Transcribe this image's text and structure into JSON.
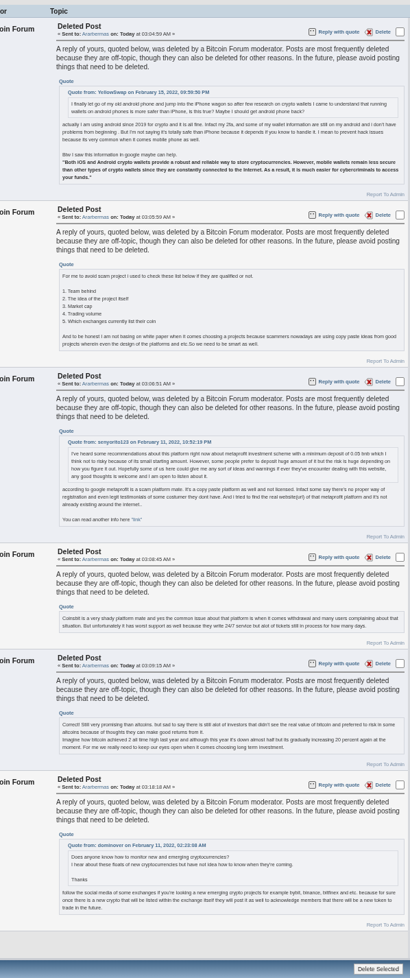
{
  "header": {
    "columns": [
      "or",
      "Topic"
    ]
  },
  "messages": [
    {
      "poster": "oin Forum",
      "title": "Deleted Post",
      "sent_prefix": "«",
      "sent_label": "Sent to:",
      "recipient": "Ararbermas",
      "on_label": "on:",
      "day": "Today",
      "time": "at 03:04:59 AM",
      "sent_suffix": "»",
      "reply": "Reply with quote",
      "delete": "Delete",
      "checked": false,
      "body": "A reply of yours, quoted below, was deleted by a Bitcoin Forum moderator. Posts are most frequently deleted because they are off-topic, though they can also be deleted for other reasons. In the future, please avoid posting things that need to be deleted.",
      "quote": {
        "label": "Quote",
        "nested": {
          "header": "Quote from: YellowSwap on February 15, 2022, 09:59:50 PM",
          "paragraphs": [
            {
              "lines": [
                "I finally let go of my old android phone and jump into the iPhone wagon so after few research on crypto wallets I came to understand that running wallets on android phones is more safer than iPhone, is this true? Maybe I should get android phone back?"
              ],
              "bold": false
            }
          ]
        },
        "paragraphs": [
          {
            "lines": [
              "actually I am using android since 2019 for crypto and it is all fine. Infact my 2fa, and some of my wallet information are still on my android and i don't have problems from beginning . But I'm not saying it's totally safe than iPhone because it depends if you know to handle it. I mean to prevent hack issues because its very common when it comes mobile phone as well."
            ],
            "bold": false
          },
          {
            "lines": [
              "Btw I saw this information in google maybe can help.",
              "**\"Both iOS and Android crypto wallets provide a robust and reliable way to store cryptocurrencies. However, mobile wallets remain less secure than other types of crypto wallets since they are constantly connected to the Internet. As a result, it is much easier for cybercriminals to access your funds.\"**"
            ],
            "bold": false
          }
        ]
      },
      "report": "Report To Admin"
    },
    {
      "poster": "oin Forum",
      "title": "Deleted Post",
      "sent_prefix": "«",
      "sent_label": "Sent to:",
      "recipient": "Ararbermas",
      "on_label": "on:",
      "day": "Today",
      "time": "at 03:05:59 AM",
      "sent_suffix": "»",
      "reply": "Reply with quote",
      "delete": "Delete",
      "checked": false,
      "body": "A reply of yours, quoted below, was deleted by a Bitcoin Forum moderator. Posts are most frequently deleted because they are off-topic, though they can also be deleted for other reasons. In the future, please avoid posting things that need to be deleted.",
      "quote": {
        "label": "Quote",
        "paragraphs": [
          {
            "lines": [
              "For me to avoid scam project i used to check these list below if they are qualified or not."
            ],
            "bold": false
          },
          {
            "lines": [
              "1. Team behind",
              "2. The idea of the project itself",
              "3. Market cap",
              "4.  Trading volume",
              "5. Which exchanges currently list their coin"
            ],
            "bold": false
          },
          {
            "lines": [
              "And to be honest I am not basing on white paper when it comes choosing a projects because scammers nowadays are using copy paste ideas from good projects wherein even the design of the platforms and etc.So we need to be smart as well."
            ],
            "bold": false
          }
        ]
      },
      "report": "Report To Admin"
    },
    {
      "poster": "oin Forum",
      "title": "Deleted Post",
      "sent_prefix": "«",
      "sent_label": "Sent to:",
      "recipient": "Ararbermas",
      "on_label": "on:",
      "day": "Today",
      "time": "at 03:06:51 AM",
      "sent_suffix": "»",
      "reply": "Reply with quote",
      "delete": "Delete",
      "checked": false,
      "body": "A reply of yours, quoted below, was deleted by a Bitcoin Forum moderator. Posts are most frequently deleted because they are off-topic, though they can also be deleted for other reasons. In the future, please avoid posting things that need to be deleted.",
      "quote": {
        "label": "Quote",
        "nested": {
          "header": "Quote from: senyorito123 on February 11, 2022, 10:52:19 PM",
          "paragraphs": [
            {
              "lines": [
                "I've heard some recommendations about this platform right now about metaprofit investment scheme with a minimum deposit of 0.05 bnb which I think not to risky because of its small starting amount. However, some people prefer to deposit huge amount of it but the risk is huge depending on how you figure it out. Hopefully some of us here could give me any sort of ideas and warnings if ever they've encounter dealing with this website, any good thoughts is welcome and I am open to listen about it."
              ],
              "bold": false
            }
          ]
        },
        "paragraphs": [
          {
            "lines": [
              "according to google metaprofit is a scam platform mate. It's a copy paste platform as well and not licensed. Infact some say there's no proper way of registration and even legit testimonials of some costumer they dont have. And i tried to find the real website(url) of that metaprofit platform and it's not already existing around the internet.."
            ],
            "bold": false
          },
          {
            "lines": [
              "You can read another info here"
            ],
            "bold": false,
            "link": "\"link\""
          }
        ]
      },
      "report": "Report To Admin"
    },
    {
      "poster": "oin Forum",
      "title": "Deleted Post",
      "sent_prefix": "«",
      "sent_label": "Sent to:",
      "recipient": "Ararbermas",
      "on_label": "on:",
      "day": "Today",
      "time": "at 03:08:45 AM",
      "sent_suffix": "»",
      "reply": "Reply with quote",
      "delete": "Delete",
      "checked": false,
      "body": "A reply of yours, quoted below, was deleted by a Bitcoin Forum moderator. Posts are most frequently deleted because they are off-topic, though they can also be deleted for other reasons. In the future, please avoid posting things that need to be deleted.",
      "quote": {
        "label": "Quote",
        "paragraphs": [
          {
            "lines": [
              "Coinsbit is a very shady platform mate and yes the common issue about that platform is when it comes withdrawal and many users complaining about that situation. But unfortunately it has worst support as well because they write 24/7 service but alot of tickets still in process for how many days."
            ],
            "bold": false
          }
        ]
      },
      "report": "Report To Admin"
    },
    {
      "poster": "oin Forum",
      "title": "Deleted Post",
      "sent_prefix": "«",
      "sent_label": "Sent to:",
      "recipient": "Ararbermas",
      "on_label": "on:",
      "day": "Today",
      "time": "at 03:09:15 AM",
      "sent_suffix": "»",
      "reply": "Reply with quote",
      "delete": "Delete",
      "checked": false,
      "body": "A reply of yours, quoted below, was deleted by a Bitcoin Forum moderator. Posts are most frequently deleted because they are off-topic, though they can also be deleted for other reasons. In the future, please avoid posting things that need to be deleted.",
      "quote": {
        "label": "Quote",
        "paragraphs": [
          {
            "lines": [
              "Correct! Still very promising than altcoins. but sad to say there is still alot of investors that didn't see the real value of bitcoin and preferred to risk in some altcoins because of thoughts they can make good returns from it.",
              "Imagine how bitcoin achieved 2 all time high last year and although this year it's down almost half but its gradually increasing 20 percent again at the moment. For me we really need to keep our eyes open when it comes choosing long term investment."
            ],
            "bold": false
          }
        ]
      },
      "report": "Report To Admin"
    },
    {
      "poster": "oin Forum",
      "title": "Deleted Post",
      "sent_prefix": "«",
      "sent_label": "Sent to:",
      "recipient": "Ararbermas",
      "on_label": "on:",
      "day": "Today",
      "time": "at 03:18:18 AM",
      "sent_suffix": "»",
      "reply": "Reply with quote",
      "delete": "Delete",
      "checked": false,
      "body": "A reply of yours, quoted below, was deleted by a Bitcoin Forum moderator. Posts are most frequently deleted because they are off-topic, though they can also be deleted for other reasons. In the future, please avoid posting things that need to be deleted.",
      "quote": {
        "label": "Quote",
        "nested": {
          "header": "Quote from: dominover on February 11, 2022, 02:23:08 AM",
          "paragraphs": [
            {
              "lines": [
                "Does anyone know how to monitor new and emerging cryptocurrencies?",
                "I hear about these floats of new cryptocurrencies but have not idea how to know when they're coming."
              ],
              "bold": false
            },
            {
              "lines": [
                "Thanks"
              ],
              "bold": false
            }
          ]
        },
        "paragraphs": [
          {
            "lines": [
              "follow the social media of some exchanges if you're looking a new emerging crypto projects for example bybit, binance, bitfinex and etc. because for sure once there is a new crypto that will be listed within the exchange itself they will post it as well to acknowledge members that there will be a new token to trade in the future."
            ],
            "bold": false
          }
        ]
      },
      "report": "Report To Admin"
    }
  ],
  "footer": {
    "button": "Delete Selected"
  }
}
